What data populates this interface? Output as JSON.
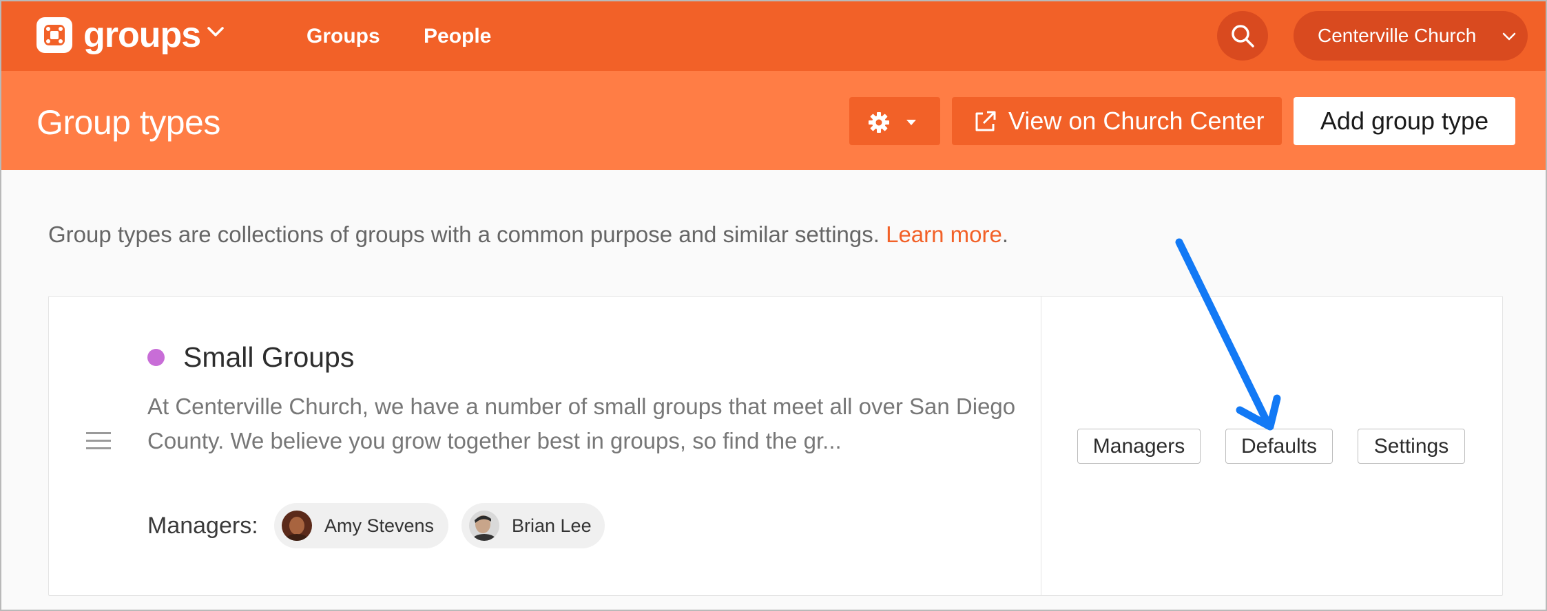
{
  "topnav": {
    "brand": "groups",
    "links": [
      "Groups",
      "People"
    ],
    "organization": "Centerville Church"
  },
  "header": {
    "title": "Group types",
    "view_button": "View on Church Center",
    "add_button": "Add group type"
  },
  "intro": {
    "text": "Group types are collections of groups with a common purpose and similar settings. ",
    "link": "Learn more",
    "tail": "."
  },
  "group_type": {
    "name": "Small Groups",
    "color": "#c86dd7",
    "description": "At Centerville Church, we have a number of small groups that meet all over San Diego County. We believe you grow together best in groups, so find the gr...",
    "managers_label": "Managers:",
    "managers": [
      "Amy Stevens",
      "Brian Lee"
    ],
    "actions": [
      "Managers",
      "Defaults",
      "Settings"
    ]
  },
  "colors": {
    "nav": "#f26128",
    "header": "#ff7d45",
    "annotation_arrow": "#1279f5"
  }
}
